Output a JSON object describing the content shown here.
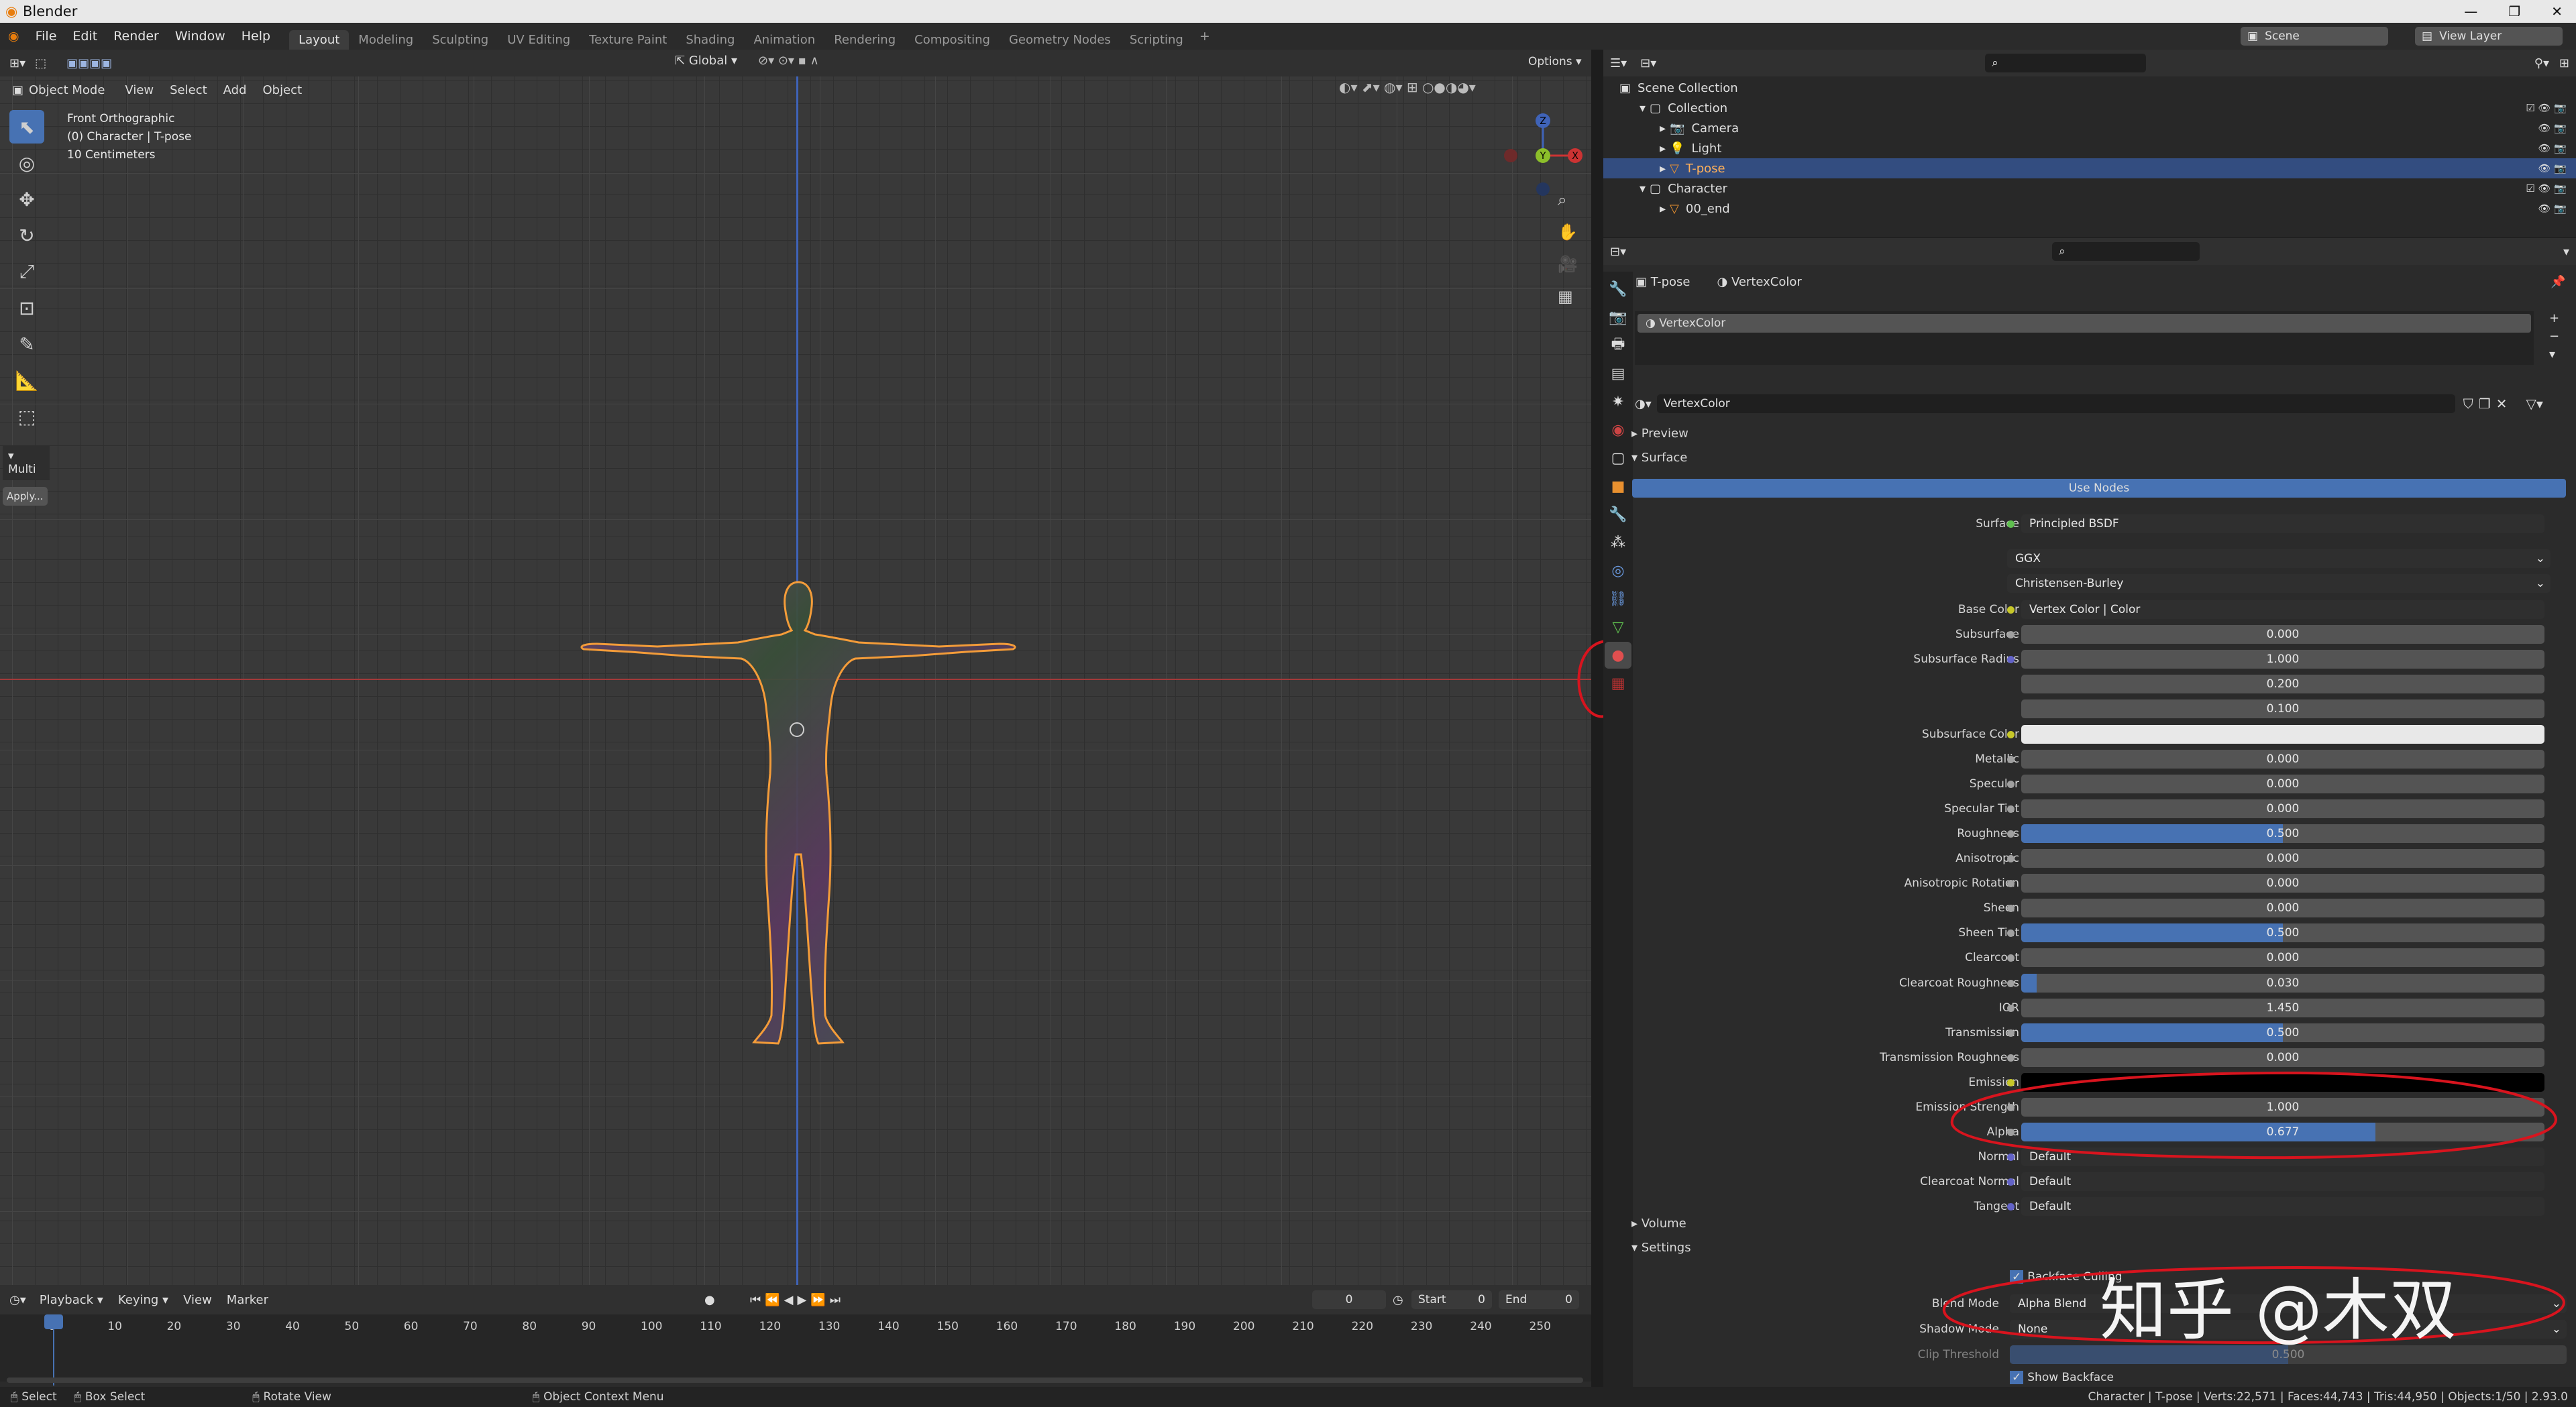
{
  "app": {
    "title": "Blender"
  },
  "menu": {
    "items": [
      "File",
      "Edit",
      "Render",
      "Window",
      "Help"
    ]
  },
  "workspaces": {
    "tabs": [
      "Layout",
      "Modeling",
      "Sculpting",
      "UV Editing",
      "Texture Paint",
      "Shading",
      "Animation",
      "Rendering",
      "Compositing",
      "Geometry Nodes",
      "Scripting"
    ],
    "active": "Layout"
  },
  "top_right": {
    "scene": "Scene",
    "view_layer": "View Layer"
  },
  "viewport": {
    "mode": "Object Mode",
    "menus": [
      "View",
      "Select",
      "Add",
      "Object"
    ],
    "orientation": "Global",
    "options": "Options",
    "overlay_lines": [
      "Front Orthographic",
      "(0) Character | T-pose",
      "10 Centimeters"
    ],
    "gizmo_axes": [
      "Z",
      "Y",
      "X"
    ],
    "side_panel": {
      "title": "Multi",
      "button": "Apply..."
    }
  },
  "outliner": {
    "root": "Scene Collection",
    "rows": [
      {
        "label": "Collection",
        "level": 1
      },
      {
        "label": "Camera",
        "level": 2
      },
      {
        "label": "Light",
        "level": 2
      },
      {
        "label": "T-pose",
        "level": 2,
        "selected": true
      },
      {
        "label": "Character",
        "level": 1
      },
      {
        "label": "00_end",
        "level": 2
      }
    ]
  },
  "properties": {
    "breadcrumb": [
      "T-pose",
      "VertexColor"
    ],
    "slot": "VertexColor",
    "material_name": "VertexColor",
    "sections": {
      "preview": "Preview",
      "surface": "Surface",
      "volume": "Volume",
      "settings": "Settings"
    },
    "use_nodes": "Use Nodes",
    "surface_shader": {
      "label": "Surface",
      "value": "Principled BSDF"
    },
    "distribution": "GGX",
    "subsurface_method": "Christensen-Burley",
    "inputs": [
      {
        "label": "Base Color",
        "value": "Vertex Color | Color",
        "dot": "#c7c729",
        "kind": "link"
      },
      {
        "label": "Subsurface",
        "value": "0.000",
        "dot": "#a0a0a0",
        "fill": 0
      },
      {
        "label": "Subsurface Radius",
        "value": "1.000",
        "dot": "#6363c7",
        "fill": 0
      },
      {
        "label": "",
        "value": "0.200",
        "fill": 0
      },
      {
        "label": "",
        "value": "0.100",
        "fill": 0
      },
      {
        "label": "Subsurface Color",
        "value": "",
        "dot": "#c7c729",
        "kind": "color",
        "color": "#e8e8e8"
      },
      {
        "label": "Metallic",
        "value": "0.000",
        "dot": "#a0a0a0",
        "fill": 0
      },
      {
        "label": "Specular",
        "value": "0.000",
        "dot": "#a0a0a0",
        "fill": 0
      },
      {
        "label": "Specular Tint",
        "value": "0.000",
        "dot": "#a0a0a0",
        "fill": 0
      },
      {
        "label": "Roughness",
        "value": "0.500",
        "dot": "#a0a0a0",
        "fill": 0.5
      },
      {
        "label": "Anisotropic",
        "value": "0.000",
        "dot": "#a0a0a0",
        "fill": 0
      },
      {
        "label": "Anisotropic Rotation",
        "value": "0.000",
        "dot": "#a0a0a0",
        "fill": 0
      },
      {
        "label": "Sheen",
        "value": "0.000",
        "dot": "#a0a0a0",
        "fill": 0
      },
      {
        "label": "Sheen Tint",
        "value": "0.500",
        "dot": "#a0a0a0",
        "fill": 0.5
      },
      {
        "label": "Clearcoat",
        "value": "0.000",
        "dot": "#a0a0a0",
        "fill": 0
      },
      {
        "label": "Clearcoat Roughness",
        "value": "0.030",
        "dot": "#a0a0a0",
        "fill": 0.03
      },
      {
        "label": "IOR",
        "value": "1.450",
        "dot": "#a0a0a0",
        "fill": 0
      },
      {
        "label": "Transmission",
        "value": "0.500",
        "dot": "#a0a0a0",
        "fill": 0.5
      },
      {
        "label": "Transmission Roughness",
        "value": "0.000",
        "dot": "#a0a0a0",
        "fill": 0
      },
      {
        "label": "Emission",
        "value": "",
        "dot": "#c7c729",
        "kind": "color",
        "color": "#000000"
      },
      {
        "label": "Emission Strength",
        "value": "1.000",
        "dot": "#a0a0a0",
        "fill": 0
      },
      {
        "label": "Alpha",
        "value": "0.677",
        "dot": "#a0a0a0",
        "fill": 0.677
      },
      {
        "label": "Normal",
        "value": "Default",
        "dot": "#6363c7",
        "kind": "link"
      },
      {
        "label": "Clearcoat Normal",
        "value": "Default",
        "dot": "#6363c7",
        "kind": "link"
      },
      {
        "label": "Tangent",
        "value": "Default",
        "dot": "#6363c7",
        "kind": "link"
      }
    ],
    "settings": {
      "backface_culling": "Backface Culling",
      "blend_mode": {
        "label": "Blend Mode",
        "value": "Alpha Blend"
      },
      "shadow_mode": {
        "label": "Shadow Mode",
        "value": "None"
      },
      "clip_threshold": {
        "label": "Clip Threshold",
        "value": "0.500"
      },
      "show_backface": "Show Backface"
    }
  },
  "timeline": {
    "menus": [
      "Playback",
      "Keying",
      "View",
      "Marker"
    ],
    "current_frame": "0",
    "start_label": "Start",
    "start": "0",
    "end_label": "End",
    "end": "0",
    "ticks": [
      "0",
      "10",
      "20",
      "30",
      "40",
      "50",
      "60",
      "70",
      "80",
      "90",
      "100",
      "110",
      "120",
      "130",
      "140",
      "150",
      "160",
      "170",
      "180",
      "190",
      "200",
      "210",
      "220",
      "230",
      "240",
      "250"
    ]
  },
  "statusbar": {
    "hints": [
      "Select",
      "Box Select",
      "Rotate View",
      "Object Context Menu"
    ],
    "stats": "Character | T-pose | Verts:22,571 | Faces:44,743 | Tris:44,950 | Objects:1/50 | 2.93.0"
  },
  "watermark": "知乎 @木双",
  "colors": {
    "accent": "#4772b3",
    "annotation": "#d8141e",
    "selection": "#ffa23a",
    "header": "#303030"
  }
}
